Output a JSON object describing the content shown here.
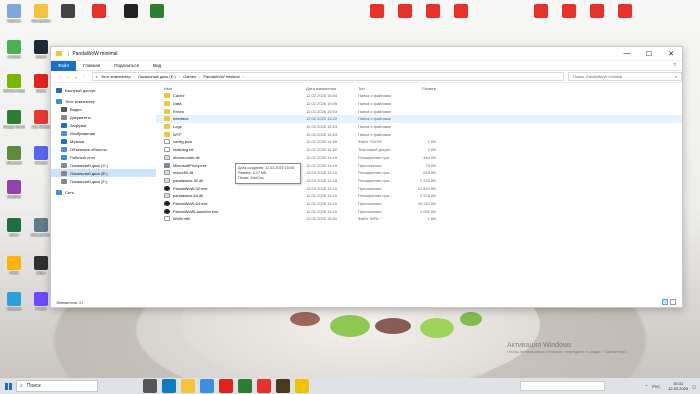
{
  "desktop": {
    "left_icons": [
      {
        "label": "Корзина",
        "icon": "recycle-bin-icon",
        "color": "#7fa7d9"
      },
      {
        "label": "Программы",
        "icon": "folder-icon",
        "color": "#f4c23c"
      },
      {
        "label": "uTorrent",
        "icon": "utorrent-icon",
        "color": "#4caf50"
      },
      {
        "label": "Steam",
        "icon": "steam-icon",
        "color": "#1b2838"
      },
      {
        "label": "GeForce Experience",
        "icon": "nvidia-icon",
        "color": "#76b900"
      },
      {
        "label": "Opera",
        "icon": "opera-icon",
        "color": "#e2231a"
      },
      {
        "label": "Google Chrome",
        "icon": "chrome-icon",
        "color": "#2e7d32"
      },
      {
        "label": "Ace Stream",
        "icon": "acestream-icon",
        "color": "#e53935"
      },
      {
        "label": "Minecraft",
        "icon": "minecraft-icon",
        "color": "#5d8c3a"
      },
      {
        "label": "Discord",
        "icon": "discord-icon",
        "color": "#5865f2"
      },
      {
        "label": "WinRAR",
        "icon": "winrar-icon",
        "color": "#8e44ad"
      },
      {
        "label": "Excel",
        "icon": "excel-icon",
        "color": "#1d6f42"
      },
      {
        "label": "Калькулятор",
        "icon": "calc-icon",
        "color": "#607d8b"
      },
      {
        "label": "Paint",
        "icon": "paint-icon",
        "color": "#ffb300"
      },
      {
        "label": "Игры",
        "icon": "game-icon",
        "color": "#303030"
      },
      {
        "label": "Telegram",
        "icon": "telegram-icon",
        "color": "#2aa1da"
      },
      {
        "label": "Proton",
        "icon": "proton-icon",
        "color": "#6d4aff"
      }
    ],
    "top_icons": [
      {
        "label": "",
        "icon": "app-icon",
        "color": "#1565c0"
      },
      {
        "label": "",
        "icon": "app-icon",
        "color": "#444"
      },
      {
        "label": "",
        "icon": "pdf-icon",
        "color": "#e8312b"
      },
      {
        "label": "",
        "icon": "swib-icon",
        "color": "#222"
      },
      {
        "label": "",
        "icon": "zl-icon",
        "color": "#2e7d32"
      }
    ]
  },
  "window": {
    "title": "PandaWoW minimal",
    "controls": {
      "minimize": "—",
      "maximize": "☐",
      "close": "✕"
    },
    "ribbon_tabs": [
      "Файл",
      "Главная",
      "Поделиться",
      "Вид"
    ],
    "help": "?",
    "breadcrumb": [
      "Этот компьютер",
      "Локальный диск (E:)",
      "Games",
      "PandaWoW minimal"
    ],
    "search_placeholder": "Поиск: PandaWoW minimal",
    "sidebar": [
      {
        "label": "Быстрый доступ",
        "icon": "star-icon",
        "color": "#1a70c9",
        "level": 0
      },
      {
        "label": "Этот компьютер",
        "icon": "computer-icon",
        "color": "#3c8fd9",
        "level": 0
      },
      {
        "label": "Видео",
        "icon": "video-icon",
        "color": "#555",
        "level": 1
      },
      {
        "label": "Документы",
        "icon": "documents-icon",
        "color": "#888",
        "level": 1
      },
      {
        "label": "Загрузки",
        "icon": "downloads-icon",
        "color": "#1a70c9",
        "level": 1
      },
      {
        "label": "Изображения",
        "icon": "pictures-icon",
        "color": "#4a90d9",
        "level": 1
      },
      {
        "label": "Музыка",
        "icon": "music-icon",
        "color": "#1a70c9",
        "level": 1
      },
      {
        "label": "Объемные объекты",
        "icon": "3d-icon",
        "color": "#4a90d9",
        "level": 1
      },
      {
        "label": "Рабочий стол",
        "icon": "desktop-icon",
        "color": "#3c8fd9",
        "level": 1
      },
      {
        "label": "Локальный диск (C:)",
        "icon": "drive-icon",
        "color": "#888",
        "level": 1
      },
      {
        "label": "Локальный диск (E:)",
        "icon": "drive-icon",
        "color": "#888",
        "level": 1,
        "selected": true
      },
      {
        "label": "Локальный диск (F:)",
        "icon": "drive-icon",
        "color": "#888",
        "level": 1
      },
      {
        "label": "Сеть",
        "icon": "network-icon",
        "color": "#3c8fd9",
        "level": 0
      }
    ],
    "columns": {
      "name": "Имя",
      "date": "Дата изменения",
      "type": "Тип",
      "size": "Размер"
    },
    "files": [
      {
        "name": "Cache",
        "date": "12.02.2025 15:04",
        "type": "Папка с файлами",
        "size": "",
        "kind": "folder"
      },
      {
        "name": "Data",
        "date": "12.02.2025 15:05",
        "type": "Папка с файлами",
        "size": "",
        "kind": "folder"
      },
      {
        "name": "Errors",
        "date": "12.02.2025 15:03",
        "type": "Папка с файлами",
        "size": "",
        "kind": "folder"
      },
      {
        "name": "Interface",
        "date": "12.02.2025 15:22",
        "type": "Папка с файлами",
        "size": "",
        "kind": "folder",
        "hover": true
      },
      {
        "name": "Logs",
        "date": "12.02.2025 15:23",
        "type": "Папка с файлами",
        "size": "",
        "kind": "folder"
      },
      {
        "name": "WTF",
        "date": "12.02.2025 15:23",
        "type": "Папка с файлами",
        "size": "",
        "kind": "folder"
      },
      {
        "name": "config.json",
        "date": "12.02.2025 14:59",
        "type": "Файл \"JSON\"",
        "size": "1 КБ",
        "kind": "file"
      },
      {
        "name": "crashlog.txt",
        "date": "12.02.2025 14:52",
        "type": "Текстовый докум...",
        "size": "2 КБ",
        "kind": "file"
      },
      {
        "name": "divxdecoder.dll",
        "date": "12.02.2025 14:19",
        "type": "Расширение при...",
        "size": "464 КБ",
        "kind": "dll"
      },
      {
        "name": "MicrosoftProxy.exe",
        "date": "12.02.2025 14:19",
        "type": "Приложение",
        "size": "76 КБ",
        "kind": "exe"
      },
      {
        "name": "msvcr80.dll",
        "date": "12.02.2025 14:19",
        "type": "Расширение при...",
        "size": "618 КБ",
        "kind": "dll"
      },
      {
        "name": "pandawow-32.dll",
        "date": "12.02.2025 14:18",
        "type": "Расширение при...",
        "size": "2 220 КБ",
        "kind": "dll"
      },
      {
        "name": "PandaWoW-32.exe",
        "date": "12.02.2025 14:19",
        "type": "Приложение",
        "size": "12 844 КБ",
        "kind": "panda"
      },
      {
        "name": "pandawow-64.dll",
        "date": "12.02.2025 14:19",
        "type": "Расширение при...",
        "size": "2 976 КБ",
        "kind": "dll"
      },
      {
        "name": "PandaWoW-64.exe",
        "date": "12.02.2025 14:19",
        "type": "Приложение",
        "size": "29 411 КБ",
        "kind": "panda"
      },
      {
        "name": "PandaWoWLauncher.exe",
        "date": "12.02.2025 14:19",
        "type": "Приложение",
        "size": "1 052 КБ",
        "kind": "panda"
      },
      {
        "name": "WoW.mfil",
        "date": "12.02.2025 15:01",
        "type": "Файл \"MFIL\"",
        "size": "1 КБ",
        "kind": "file"
      }
    ],
    "tooltip": {
      "line1": "Дата создания: 12.02.2025 15:08",
      "line2": "Размер: 5,37 МБ",
      "line3": "Папки: AddOns"
    },
    "status": "Элементов: 17"
  },
  "activation": {
    "title": "Активация Windows",
    "subtitle": "Чтобы активировать Windows, перейдите в раздел \"Параметры\"."
  },
  "taskbar": {
    "search_placeholder": "Поиск",
    "apps": [
      {
        "icon": "task-view-icon",
        "color": "#555"
      },
      {
        "icon": "edge-icon",
        "color": "#0f7bbf"
      },
      {
        "icon": "explorer-icon",
        "color": "#f4c23c"
      },
      {
        "icon": "store-icon",
        "color": "#3c8fd9"
      },
      {
        "icon": "opera-icon",
        "color": "#e2231a"
      },
      {
        "icon": "xl-icon",
        "color": "#2e7d32"
      },
      {
        "icon": "pdf-icon",
        "color": "#e8312b"
      },
      {
        "icon": "wow-icon",
        "color": "#4a3a1a"
      },
      {
        "icon": "yandex-icon",
        "color": "#f2c200"
      }
    ],
    "lang": "РУС",
    "time": "15:31",
    "date": "12.02.2025"
  }
}
